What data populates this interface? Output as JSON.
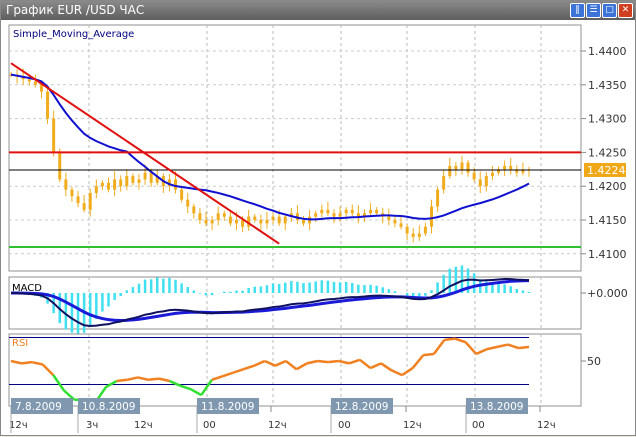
{
  "window": {
    "title": "График EUR /USD  ЧАС",
    "buttons": [
      "tile-vertical",
      "tile-horizontal",
      "maximize",
      "close"
    ]
  },
  "colors": {
    "candle": "#f0ac1c",
    "sma": "#1010d0",
    "trend": "#e01010",
    "resistance": "#e01010",
    "support": "#30c030",
    "current": "#000000",
    "macd": "#101060",
    "signal": "#1a1ad8",
    "hist": "#40e0f0",
    "rsi": "#f08020",
    "rsi_low": "#30e030",
    "rsi_levels": "#000080"
  },
  "chart_data": {
    "type": "line",
    "title": "Simple_Moving_Average",
    "symbol": "EUR/USD",
    "timeframe": "H1",
    "ylim": [
      1.4085,
      1.442
    ],
    "y_ticks": [
      "1.4400",
      "1.4350",
      "1.4300",
      "1.4250",
      "1.4200",
      "1.4150",
      "1.4100"
    ],
    "current_price": "1.4224",
    "hlines": {
      "resistance": 1.425,
      "current": 1.4224,
      "support": 1.411
    },
    "trendline": {
      "start_bar": 0,
      "start_price": 1.4382,
      "end_bar": 44,
      "end_price": 1.4115
    },
    "closes": [
      1.4365,
      1.4362,
      1.4358,
      1.4355,
      1.435,
      1.434,
      1.43,
      1.425,
      1.421,
      1.4195,
      1.4185,
      1.4175,
      1.4165,
      1.419,
      1.42,
      1.4205,
      1.4195,
      1.421,
      1.42,
      1.4215,
      1.4205,
      1.421,
      1.422,
      1.4205,
      1.4215,
      1.42,
      1.421,
      1.4195,
      1.418,
      1.417,
      1.416,
      1.415,
      1.4145,
      1.415,
      1.416,
      1.4155,
      1.4145,
      1.415,
      1.414,
      1.4155,
      1.415,
      1.4145,
      1.415,
      1.4155,
      1.4145,
      1.4155,
      1.416,
      1.415,
      1.4145,
      1.4155,
      1.416,
      1.4165,
      1.416,
      1.4155,
      1.416,
      1.4165,
      1.416,
      1.4155,
      1.416,
      1.4165,
      1.416,
      1.4155,
      1.415,
      1.4145,
      1.414,
      1.413,
      1.4125,
      1.413,
      1.414,
      1.417,
      1.4195,
      1.4215,
      1.423,
      1.4225,
      1.4235,
      1.422,
      1.421,
      1.42,
      1.4215,
      1.422,
      1.4225,
      1.423,
      1.4225,
      1.422,
      1.4225,
      1.4224
    ],
    "macd_panel": {
      "label": "MACD",
      "zero_label": "+0.000"
    },
    "rsi_panel": {
      "label": "RSI",
      "mid_label": "50",
      "levels": [
        70,
        30
      ],
      "values": [
        50,
        48,
        49,
        47,
        38,
        25,
        17,
        17,
        15,
        28,
        33,
        34,
        36,
        34,
        35,
        33,
        29,
        26,
        21,
        34,
        37,
        40,
        43,
        46,
        50,
        46,
        50,
        43,
        48,
        50,
        49,
        50,
        48,
        51,
        44,
        48,
        42,
        38,
        44,
        55,
        56,
        68,
        69,
        66,
        56,
        60,
        62,
        64,
        61,
        62
      ]
    },
    "date_labels": [
      "7.8.2009",
      "10.8.2009",
      "11.8.2009",
      "12.8.2009",
      "13.8.2009"
    ],
    "hour_labels": [
      "12ч",
      "3ч",
      "12ч",
      "00",
      "12ч",
      "00",
      "12ч",
      "00",
      "12ч"
    ]
  }
}
